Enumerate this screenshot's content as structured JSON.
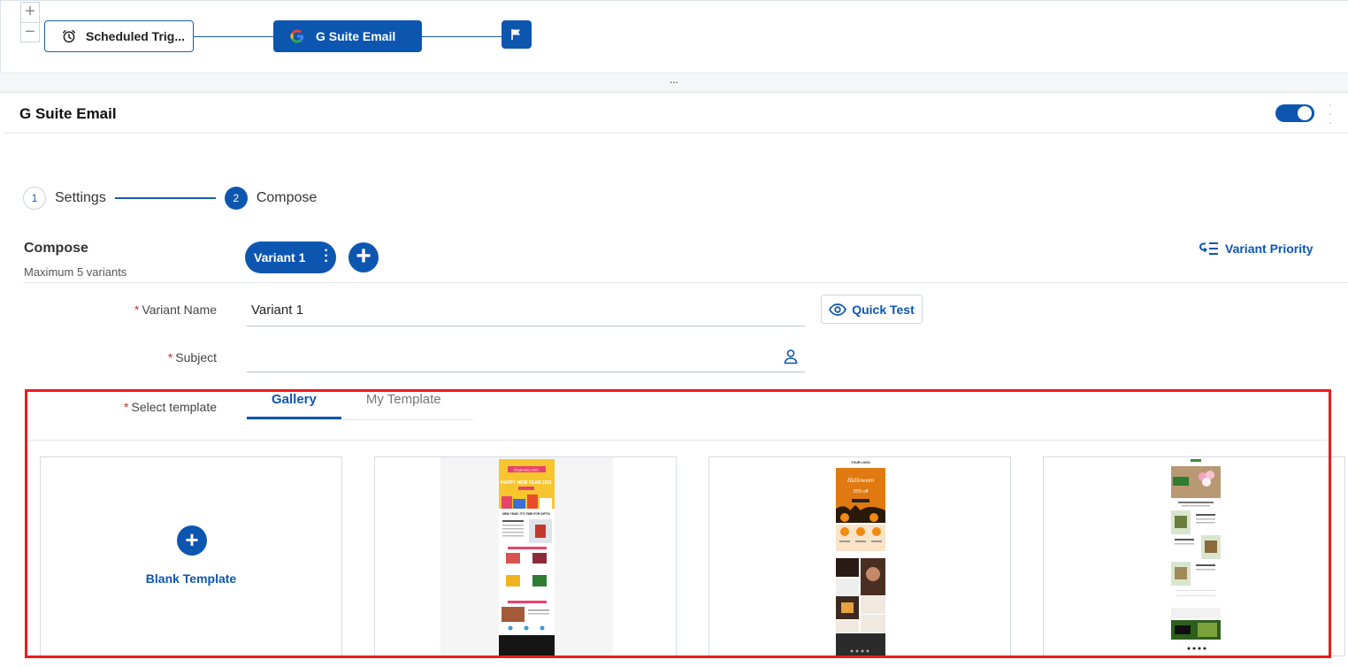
{
  "workflow": {
    "zoom_in": "+",
    "zoom_out": "−",
    "trigger_label": "Scheduled Trig...",
    "gsuite_label": "G Suite Email"
  },
  "resizer": {
    "handle": "..."
  },
  "panel": {
    "title": "G Suite Email"
  },
  "stepper": {
    "steps": [
      {
        "number": "1",
        "label": "Settings"
      },
      {
        "number": "2",
        "label": "Compose"
      }
    ]
  },
  "compose": {
    "title": "Compose",
    "subtitle": "Maximum 5 variants",
    "variant_pill": "Variant 1",
    "variant_priority": "Variant Priority"
  },
  "form": {
    "required_mark": "*",
    "variant_name_label": "Variant Name",
    "variant_name_value": "Variant 1",
    "subject_label": "Subject",
    "subject_value": "",
    "quick_test": "Quick Test",
    "select_template_label": "Select template"
  },
  "template_tabs": [
    {
      "label": "Gallery",
      "active": true
    },
    {
      "label": "My Template",
      "active": false
    }
  ],
  "gallery": {
    "blank_label": "Blank Template",
    "ny_badge": "25 january 2021",
    "ny_headline": "HAPPY NEW YEAR 2021",
    "ny_subhead": "NEW YEAR. IT'S TIME FOR GIFTS!",
    "hw_logo": "YOUR LOGO",
    "hw_headline": "Halloween",
    "hw_offer": "25% off"
  },
  "colors": {
    "primary": "#0d56b0",
    "highlight": "#ee1b1b",
    "required": "#d12a2a"
  }
}
